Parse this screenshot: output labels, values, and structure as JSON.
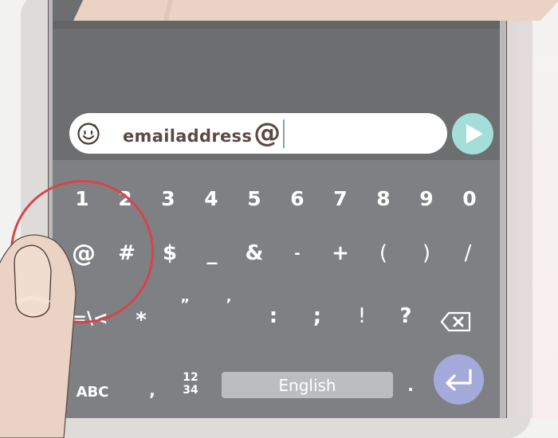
{
  "input": {
    "value_text": "emailaddress",
    "value_at": "@",
    "emoji_icon": "smiley-icon",
    "send_icon": "play-icon"
  },
  "keyboard": {
    "row1": [
      "1",
      "2",
      "3",
      "4",
      "5",
      "6",
      "7",
      "8",
      "9",
      "0"
    ],
    "row2": [
      "@",
      "#",
      "$",
      "_",
      "&",
      "-",
      "+",
      "(",
      ")",
      "/"
    ],
    "row3": [
      "=\\<",
      "*",
      "”",
      "’",
      ":",
      ";",
      "!",
      "?"
    ],
    "bottom": {
      "abc_label": "ABC",
      "comma_label": ",",
      "num_top": "12",
      "num_bottom": "34",
      "space_label": "English",
      "period_label": "."
    },
    "backspace_icon": "backspace-icon",
    "enter_icon": "enter-icon"
  },
  "colors": {
    "screen_top": "#6d6e70",
    "keyboard_bg": "#7f8083",
    "send_button": "#a3dfd8",
    "enter_button": "#a4abdb",
    "highlight_circle": "#d9434a",
    "input_text": "#5b4a44"
  }
}
